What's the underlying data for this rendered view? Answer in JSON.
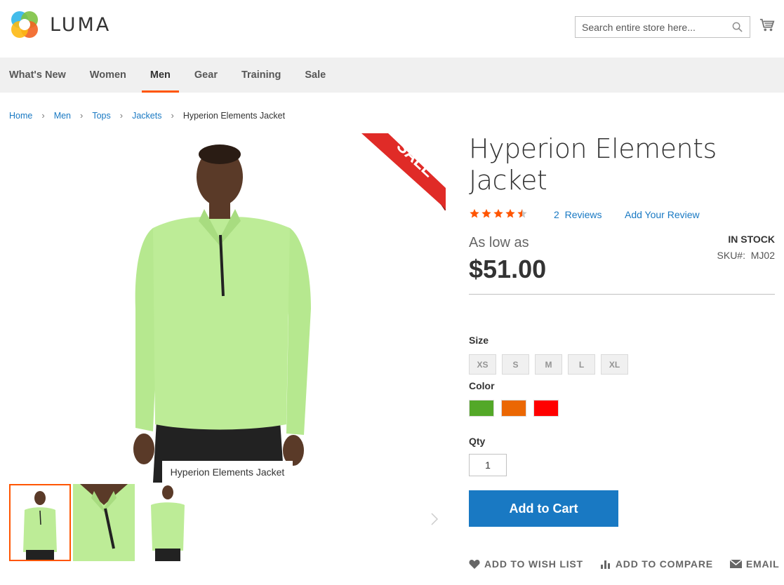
{
  "brand": {
    "name": "LUMA"
  },
  "search": {
    "placeholder": "Search entire store here..."
  },
  "nav": {
    "items": [
      {
        "label": "What's New",
        "active": false
      },
      {
        "label": "Women",
        "active": false
      },
      {
        "label": "Men",
        "active": true
      },
      {
        "label": "Gear",
        "active": false
      },
      {
        "label": "Training",
        "active": false
      },
      {
        "label": "Sale",
        "active": false
      }
    ]
  },
  "breadcrumbs": {
    "items": [
      "Home",
      "Men",
      "Tops",
      "Jackets"
    ],
    "current": "Hyperion Elements Jacket"
  },
  "gallery": {
    "sale_badge": "SALE",
    "caption": "Hyperion Elements Jacket",
    "thumbnail_count": 3
  },
  "product": {
    "title": "Hyperion Elements Jacket",
    "rating": 4.5,
    "reviews_count": "2",
    "reviews_label": "Reviews",
    "add_review_label": "Add Your Review",
    "price_prefix": "As low as",
    "price": "$51.00",
    "stock_status": "IN STOCK",
    "sku_label": "SKU#:",
    "sku": "MJ02"
  },
  "options": {
    "size_label": "Size",
    "sizes": [
      "XS",
      "S",
      "M",
      "L",
      "XL"
    ],
    "color_label": "Color",
    "colors": [
      "#53a828",
      "#eb6703",
      "#ff0000"
    ],
    "qty_label": "Qty",
    "qty_value": "1"
  },
  "buttons": {
    "add_to_cart": "Add to Cart"
  },
  "actions": {
    "wishlist": "ADD TO WISH LIST",
    "compare": "ADD TO COMPARE",
    "email": "EMAIL"
  },
  "colors": {
    "accent": "#ff5501",
    "primary": "#1979c3",
    "star": "#ff5501",
    "nav_bg": "#f0f0f0"
  }
}
